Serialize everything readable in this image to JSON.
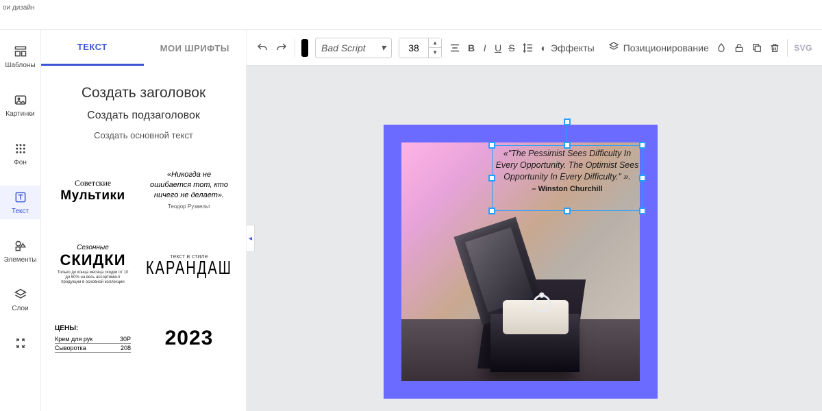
{
  "header": {
    "my_designs": "ои дизайн"
  },
  "rail": {
    "templates": "Шаблоны",
    "images": "Картинки",
    "background": "Фон",
    "text": "Текст",
    "elements": "Элементы",
    "layers": "Слои"
  },
  "panel": {
    "tabs": {
      "text": "ТЕКСТ",
      "my_fonts": "МОИ ШРИФТЫ"
    },
    "add_heading": "Создать заголовок",
    "add_subheading": "Создать подзаголовок",
    "add_body": "Создать основной текст",
    "cards": {
      "c1a": "Советские",
      "c1b": "Мультики",
      "c2q": "«Никогда не ошибается тот, кто ничего не делает».",
      "c2au": "Теодор Рузвельт",
      "c3a": "Сезонные",
      "c3b": "СКИДКИ",
      "c3c": "Только до конца месяца скидки от 10 до 60% на весь ассортимент продукции в основной коллекции",
      "c4a": "текст в стиле",
      "c4b": "КАРАНДАШ",
      "c5t": "ЦЕНЫ:",
      "c5r1a": "Крем для рук",
      "c5r1b": "30Р",
      "c5r2a": "Сыворотка",
      "c5r2b": "208",
      "c6": "2023"
    }
  },
  "toolbar": {
    "font": "Bad Script",
    "size": "38",
    "effects": "Эффекты",
    "position": "Позиционирование",
    "svg": "SVG"
  },
  "canvas": {
    "quote": "«\"The Pessimist Sees Difficulty In Every Opportunity. The Optimist Sees Opportunity In Every Difficulty.\" ».",
    "author": "– Winston Churchill"
  },
  "colors": {
    "accent": "#3a56d4",
    "frame": "#6b6cff",
    "selection": "#29a0ff"
  }
}
